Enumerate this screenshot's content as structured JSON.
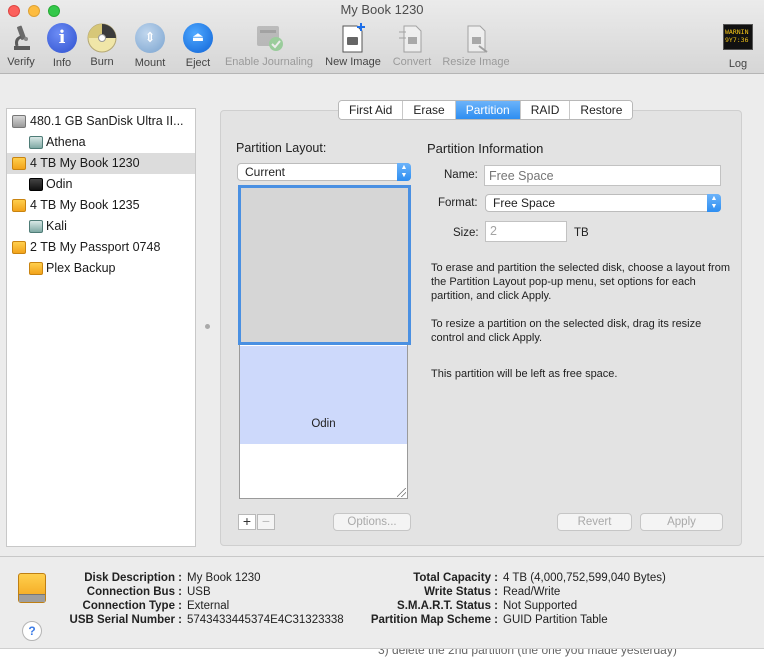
{
  "window": {
    "title": "My Book 1230"
  },
  "toolbar": [
    {
      "label": "Verify",
      "icon": "microscope-icon",
      "enabled": true
    },
    {
      "label": "Info",
      "icon": "info-icon",
      "enabled": true
    },
    {
      "label": "Burn",
      "icon": "burn-icon",
      "enabled": true
    },
    {
      "label": "Mount",
      "icon": "mount-icon",
      "enabled": true
    },
    {
      "label": "Eject",
      "icon": "eject-icon",
      "enabled": true
    },
    {
      "label": "Enable Journaling",
      "icon": "journaling-icon",
      "enabled": false
    },
    {
      "label": "New Image",
      "icon": "new-image-icon",
      "enabled": true
    },
    {
      "label": "Convert",
      "icon": "convert-icon",
      "enabled": false
    },
    {
      "label": "Resize Image",
      "icon": "resize-image-icon",
      "enabled": false
    },
    {
      "label": "Log",
      "icon": "log-icon",
      "enabled": true,
      "icon_text": "WARNIN\n9Y7:36"
    }
  ],
  "sidebar": {
    "items": [
      {
        "label": "480.1 GB SanDisk Ultra II...",
        "level": 0,
        "icon": "internal-drive-icon",
        "selected": false
      },
      {
        "label": "Athena",
        "level": 1,
        "icon": "volume-icon",
        "selected": false
      },
      {
        "label": "4 TB My Book 1230",
        "level": 0,
        "icon": "external-drive-icon",
        "selected": true
      },
      {
        "label": "Odin",
        "level": 1,
        "icon": "volume-icon",
        "selected": false
      },
      {
        "label": "4 TB My Book 1235",
        "level": 0,
        "icon": "external-drive-icon",
        "selected": false
      },
      {
        "label": "Kali",
        "level": 1,
        "icon": "volume-icon",
        "selected": false
      },
      {
        "label": "2 TB My Passport 0748",
        "level": 0,
        "icon": "external-drive-icon",
        "selected": false
      },
      {
        "label": "Plex Backup",
        "level": 1,
        "icon": "volume-icon",
        "selected": false
      }
    ]
  },
  "tabs": [
    {
      "label": "First Aid",
      "active": false
    },
    {
      "label": "Erase",
      "active": false
    },
    {
      "label": "Partition",
      "active": true
    },
    {
      "label": "RAID",
      "active": false
    },
    {
      "label": "Restore",
      "active": false
    }
  ],
  "partition": {
    "layout_label": "Partition Layout:",
    "layout_value": "Current",
    "segments": {
      "free_label": "",
      "odin_label": "Odin"
    },
    "add_label": "+",
    "remove_label": "−",
    "options_label": "Options...",
    "revert_label": "Revert",
    "apply_label": "Apply",
    "info": {
      "heading": "Partition Information",
      "name_label": "Name:",
      "name_placeholder": "Free Space",
      "format_label": "Format:",
      "format_value": "Free Space",
      "size_label": "Size:",
      "size_value": "2",
      "size_unit": "TB",
      "help_1": "To erase and partition the selected disk, choose a layout from the Partition Layout pop-up menu, set options for each partition, and click Apply.",
      "help_2": "To resize a partition on the selected disk, drag its resize control and click Apply.",
      "help_3": "This partition will be left as free space."
    }
  },
  "details": {
    "left": [
      {
        "key": "Disk Description :",
        "value": "My Book 1230"
      },
      {
        "key": "Connection Bus :",
        "value": "USB"
      },
      {
        "key": "Connection Type :",
        "value": "External"
      },
      {
        "key": "USB Serial Number :",
        "value": "5743433445374E4C31323338"
      }
    ],
    "right": [
      {
        "key": "Total Capacity :",
        "value": "4 TB (4,000,752,599,040 Bytes)"
      },
      {
        "key": "Write Status :",
        "value": "Read/Write"
      },
      {
        "key": "S.M.A.R.T. Status :",
        "value": "Not Supported"
      },
      {
        "key": "Partition Map Scheme :",
        "value": "GUID Partition Table"
      }
    ]
  },
  "help_label": "?",
  "behind_text": "3) delete the 2nd partition (the one you made yesterday)"
}
